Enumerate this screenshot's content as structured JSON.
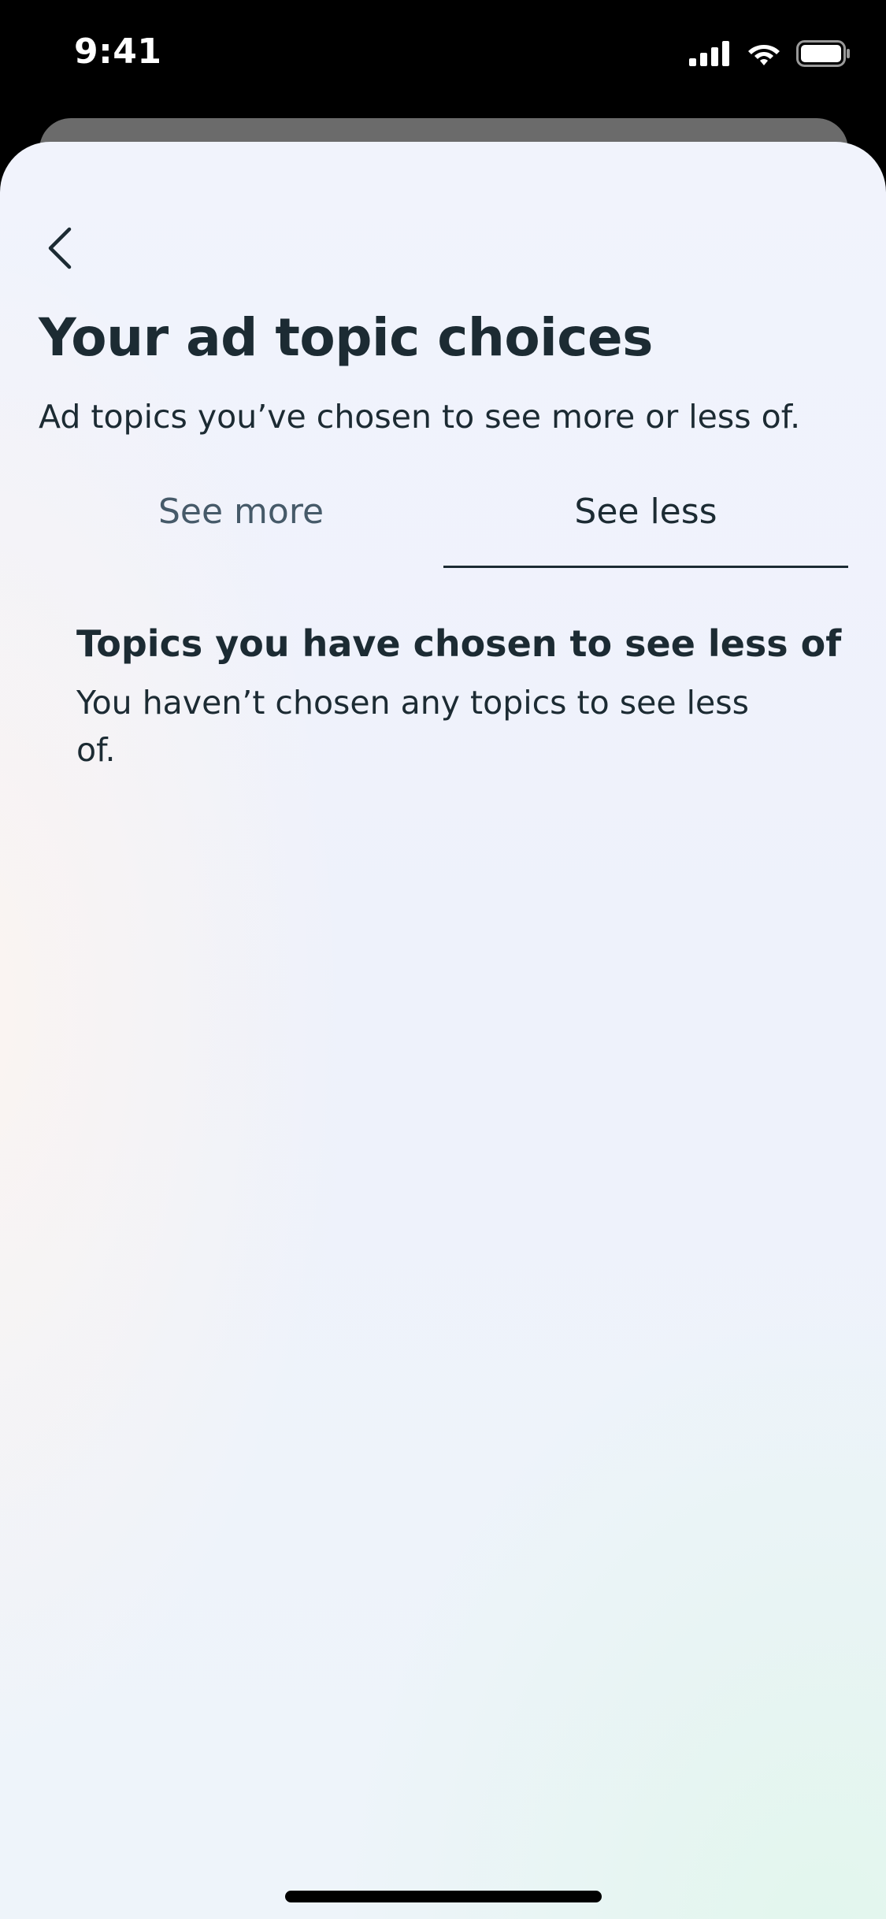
{
  "status_bar": {
    "time": "9:41"
  },
  "header": {
    "back_icon": "chevron-left-icon",
    "title": "Your ad topic choices",
    "subtitle": "Ad topics you’ve chosen to see more or less of."
  },
  "tabs": [
    {
      "label": "See more",
      "selected": false
    },
    {
      "label": "See less",
      "selected": true
    }
  ],
  "section": {
    "title": "Topics you have chosen to see less of",
    "body": "You haven’t chosen any topics to see less of."
  },
  "colors": {
    "text_primary": "#1c2b33",
    "text_secondary": "#465a69",
    "background_top": "#000000"
  }
}
